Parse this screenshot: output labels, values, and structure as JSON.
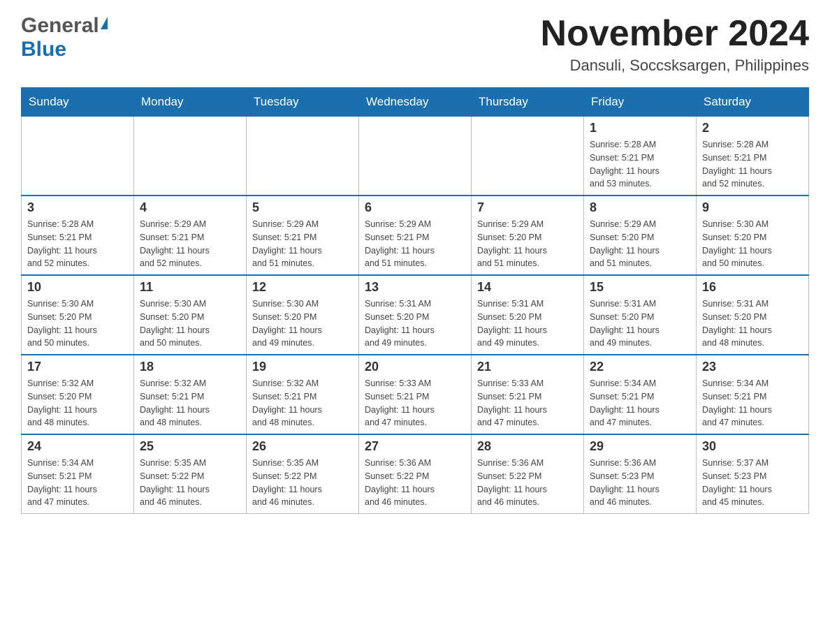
{
  "header": {
    "logo_general": "General",
    "logo_blue": "Blue",
    "month_title": "November 2024",
    "location": "Dansuli, Soccsksargen, Philippines"
  },
  "weekdays": [
    "Sunday",
    "Monday",
    "Tuesday",
    "Wednesday",
    "Thursday",
    "Friday",
    "Saturday"
  ],
  "weeks": [
    [
      {
        "day": "",
        "info": ""
      },
      {
        "day": "",
        "info": ""
      },
      {
        "day": "",
        "info": ""
      },
      {
        "day": "",
        "info": ""
      },
      {
        "day": "",
        "info": ""
      },
      {
        "day": "1",
        "info": "Sunrise: 5:28 AM\nSunset: 5:21 PM\nDaylight: 11 hours\nand 53 minutes."
      },
      {
        "day": "2",
        "info": "Sunrise: 5:28 AM\nSunset: 5:21 PM\nDaylight: 11 hours\nand 52 minutes."
      }
    ],
    [
      {
        "day": "3",
        "info": "Sunrise: 5:28 AM\nSunset: 5:21 PM\nDaylight: 11 hours\nand 52 minutes."
      },
      {
        "day": "4",
        "info": "Sunrise: 5:29 AM\nSunset: 5:21 PM\nDaylight: 11 hours\nand 52 minutes."
      },
      {
        "day": "5",
        "info": "Sunrise: 5:29 AM\nSunset: 5:21 PM\nDaylight: 11 hours\nand 51 minutes."
      },
      {
        "day": "6",
        "info": "Sunrise: 5:29 AM\nSunset: 5:21 PM\nDaylight: 11 hours\nand 51 minutes."
      },
      {
        "day": "7",
        "info": "Sunrise: 5:29 AM\nSunset: 5:20 PM\nDaylight: 11 hours\nand 51 minutes."
      },
      {
        "day": "8",
        "info": "Sunrise: 5:29 AM\nSunset: 5:20 PM\nDaylight: 11 hours\nand 51 minutes."
      },
      {
        "day": "9",
        "info": "Sunrise: 5:30 AM\nSunset: 5:20 PM\nDaylight: 11 hours\nand 50 minutes."
      }
    ],
    [
      {
        "day": "10",
        "info": "Sunrise: 5:30 AM\nSunset: 5:20 PM\nDaylight: 11 hours\nand 50 minutes."
      },
      {
        "day": "11",
        "info": "Sunrise: 5:30 AM\nSunset: 5:20 PM\nDaylight: 11 hours\nand 50 minutes."
      },
      {
        "day": "12",
        "info": "Sunrise: 5:30 AM\nSunset: 5:20 PM\nDaylight: 11 hours\nand 49 minutes."
      },
      {
        "day": "13",
        "info": "Sunrise: 5:31 AM\nSunset: 5:20 PM\nDaylight: 11 hours\nand 49 minutes."
      },
      {
        "day": "14",
        "info": "Sunrise: 5:31 AM\nSunset: 5:20 PM\nDaylight: 11 hours\nand 49 minutes."
      },
      {
        "day": "15",
        "info": "Sunrise: 5:31 AM\nSunset: 5:20 PM\nDaylight: 11 hours\nand 49 minutes."
      },
      {
        "day": "16",
        "info": "Sunrise: 5:31 AM\nSunset: 5:20 PM\nDaylight: 11 hours\nand 48 minutes."
      }
    ],
    [
      {
        "day": "17",
        "info": "Sunrise: 5:32 AM\nSunset: 5:20 PM\nDaylight: 11 hours\nand 48 minutes."
      },
      {
        "day": "18",
        "info": "Sunrise: 5:32 AM\nSunset: 5:21 PM\nDaylight: 11 hours\nand 48 minutes."
      },
      {
        "day": "19",
        "info": "Sunrise: 5:32 AM\nSunset: 5:21 PM\nDaylight: 11 hours\nand 48 minutes."
      },
      {
        "day": "20",
        "info": "Sunrise: 5:33 AM\nSunset: 5:21 PM\nDaylight: 11 hours\nand 47 minutes."
      },
      {
        "day": "21",
        "info": "Sunrise: 5:33 AM\nSunset: 5:21 PM\nDaylight: 11 hours\nand 47 minutes."
      },
      {
        "day": "22",
        "info": "Sunrise: 5:34 AM\nSunset: 5:21 PM\nDaylight: 11 hours\nand 47 minutes."
      },
      {
        "day": "23",
        "info": "Sunrise: 5:34 AM\nSunset: 5:21 PM\nDaylight: 11 hours\nand 47 minutes."
      }
    ],
    [
      {
        "day": "24",
        "info": "Sunrise: 5:34 AM\nSunset: 5:21 PM\nDaylight: 11 hours\nand 47 minutes."
      },
      {
        "day": "25",
        "info": "Sunrise: 5:35 AM\nSunset: 5:22 PM\nDaylight: 11 hours\nand 46 minutes."
      },
      {
        "day": "26",
        "info": "Sunrise: 5:35 AM\nSunset: 5:22 PM\nDaylight: 11 hours\nand 46 minutes."
      },
      {
        "day": "27",
        "info": "Sunrise: 5:36 AM\nSunset: 5:22 PM\nDaylight: 11 hours\nand 46 minutes."
      },
      {
        "day": "28",
        "info": "Sunrise: 5:36 AM\nSunset: 5:22 PM\nDaylight: 11 hours\nand 46 minutes."
      },
      {
        "day": "29",
        "info": "Sunrise: 5:36 AM\nSunset: 5:23 PM\nDaylight: 11 hours\nand 46 minutes."
      },
      {
        "day": "30",
        "info": "Sunrise: 5:37 AM\nSunset: 5:23 PM\nDaylight: 11 hours\nand 45 minutes."
      }
    ]
  ]
}
